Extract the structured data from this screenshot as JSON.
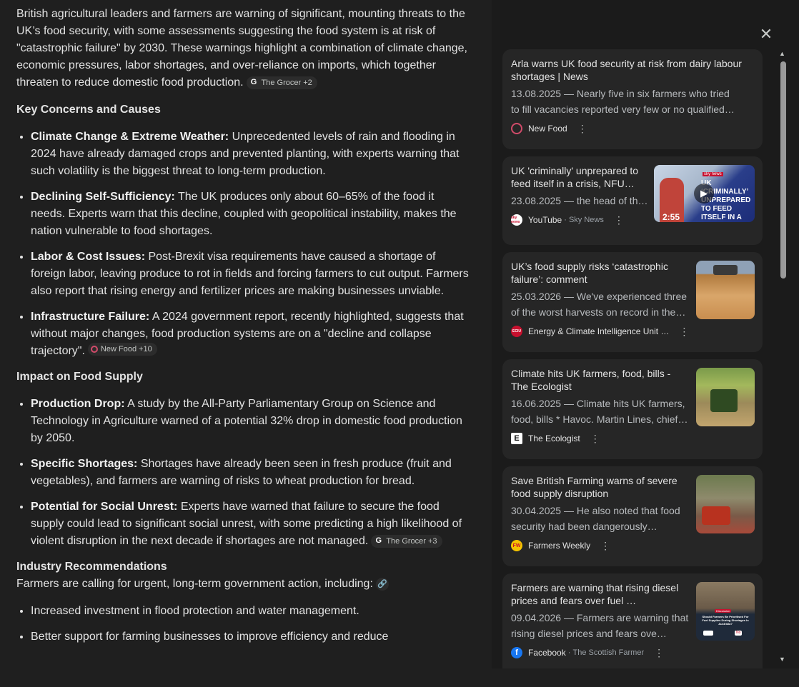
{
  "summary": {
    "intro": "British agricultural leaders and farmers are warning of significant, mounting threats to the UK’s food security, with some assessments suggesting the food system is at risk of \"catastrophic failure\" by 2030. These warnings highlight a combination of climate change, economic pressures, labor shortages, and over-reliance on imports, which together threaten to reduce domestic food production.",
    "intro_chip": "The Grocer +2",
    "section1_title": "Key Concerns and Causes",
    "section1_items": [
      {
        "bold": "Climate Change & Extreme Weather:",
        "text": " Unprecedented levels of rain and flooding in 2024 have already damaged crops and prevented planting, with experts warning that such volatility is the biggest threat to long-term production."
      },
      {
        "bold": "Declining Self-Sufficiency:",
        "text": " The UK produces only about 60–65% of the food it needs. Experts warn that this decline, coupled with geopolitical instability, makes the nation vulnerable to food shortages."
      },
      {
        "bold": "Labor & Cost Issues:",
        "text": " Post-Brexit visa requirements have caused a shortage of foreign labor, leaving produce to rot in fields and forcing farmers to cut output. Farmers also report that rising energy and fertilizer prices are making businesses unviable."
      },
      {
        "bold": "Infrastructure Failure:",
        "text": " A 2024 government report, recently highlighted, suggests that without major changes, food production systems are on a \"decline and collapse trajectory\".",
        "chip": "New Food +10"
      }
    ],
    "section2_title": "Impact on Food Supply",
    "section2_items": [
      {
        "bold": "Production Drop:",
        "text": " A study by the All-Party Parliamentary Group on Science and Technology in Agriculture warned of a potential 32% drop in domestic food production by 2050."
      },
      {
        "bold": "Specific Shortages:",
        "text": " Shortages have already been seen in fresh produce (fruit and vegetables), and farmers are warning of risks to wheat production for bread."
      },
      {
        "bold": "Potential for Social Unrest:",
        "text": " Experts have warned that failure to secure the food supply could lead to significant social unrest, with some predicting a high likelihood of violent disruption in the next decade if shortages are not managed.",
        "chip": "The Grocer +3"
      }
    ],
    "section3_title": "Industry Recommendations",
    "section3_intro": "Farmers are calling for urgent, long-term government action, including:",
    "section3_items": [
      "Increased investment in flood protection and water management.",
      "Better support for farming businesses to improve efficiency and reduce"
    ]
  },
  "panel": {
    "close_icon": "close-icon",
    "cards": [
      {
        "title": "Arla warns UK food security at risk from dairy labour shortages | News",
        "date": "13.08.2025",
        "snippet": "Nearly five in six farmers who tried to fill vacancies reported very few or no qualified…",
        "source": "New Food",
        "source_sub": "",
        "icon_color": "#d14b6a"
      },
      {
        "title": "UK 'criminally' unprepared to feed itself in a crisis, NFU…",
        "date": "23.08.2025",
        "snippet": "the head of th…",
        "source": "YouTube",
        "source_sub": "Sky News",
        "video_duration": "2:55",
        "video_caption": "UK ‘CRIMINALLY’ UNPREPARED TO FEED ITSELF IN A CRISIS",
        "video_logo": "sky news",
        "icon_text": "sky news"
      },
      {
        "title": "UK’s food supply risks ‘catastrophic failure’: comment",
        "date": "25.03.2026",
        "snippet": "We've experienced three of the worst harvests on record in the…",
        "source": "Energy & Climate Intelligence Unit …",
        "source_sub": "",
        "icon_text": "ECIU",
        "icon_color": "#c8102e"
      },
      {
        "title": "Climate hits UK farmers, food, bills - The Ecologist",
        "date": "16.06.2025",
        "snippet": "Climate hits UK farmers, food, bills * Havoc. Martin Lines, chief…",
        "source": "The Ecologist",
        "source_sub": "",
        "icon_text": "E"
      },
      {
        "title": "Save British Farming warns of severe food supply disruption",
        "date": "30.04.2025",
        "snippet": "He also noted that food security had been dangerously…",
        "source": "Farmers Weekly",
        "source_sub": "",
        "icon_text": "FW",
        "icon_color": "#f5c400"
      },
      {
        "title": "Farmers are warning that rising diesel prices and fears over fuel …",
        "date": "09.04.2026",
        "snippet": "Farmers are warning that rising diesel prices and fears ove…",
        "source": "Facebook",
        "source_sub": "The Scottish Farmer",
        "icon_text": "f",
        "icon_color": "#1877f2",
        "thumb_caption": "Should Farmers Be Prioritised For Fuel Supplies During Shortages In Australia?",
        "thumb_badge": "Discussion",
        "thumb_no": "No"
      }
    ]
  }
}
